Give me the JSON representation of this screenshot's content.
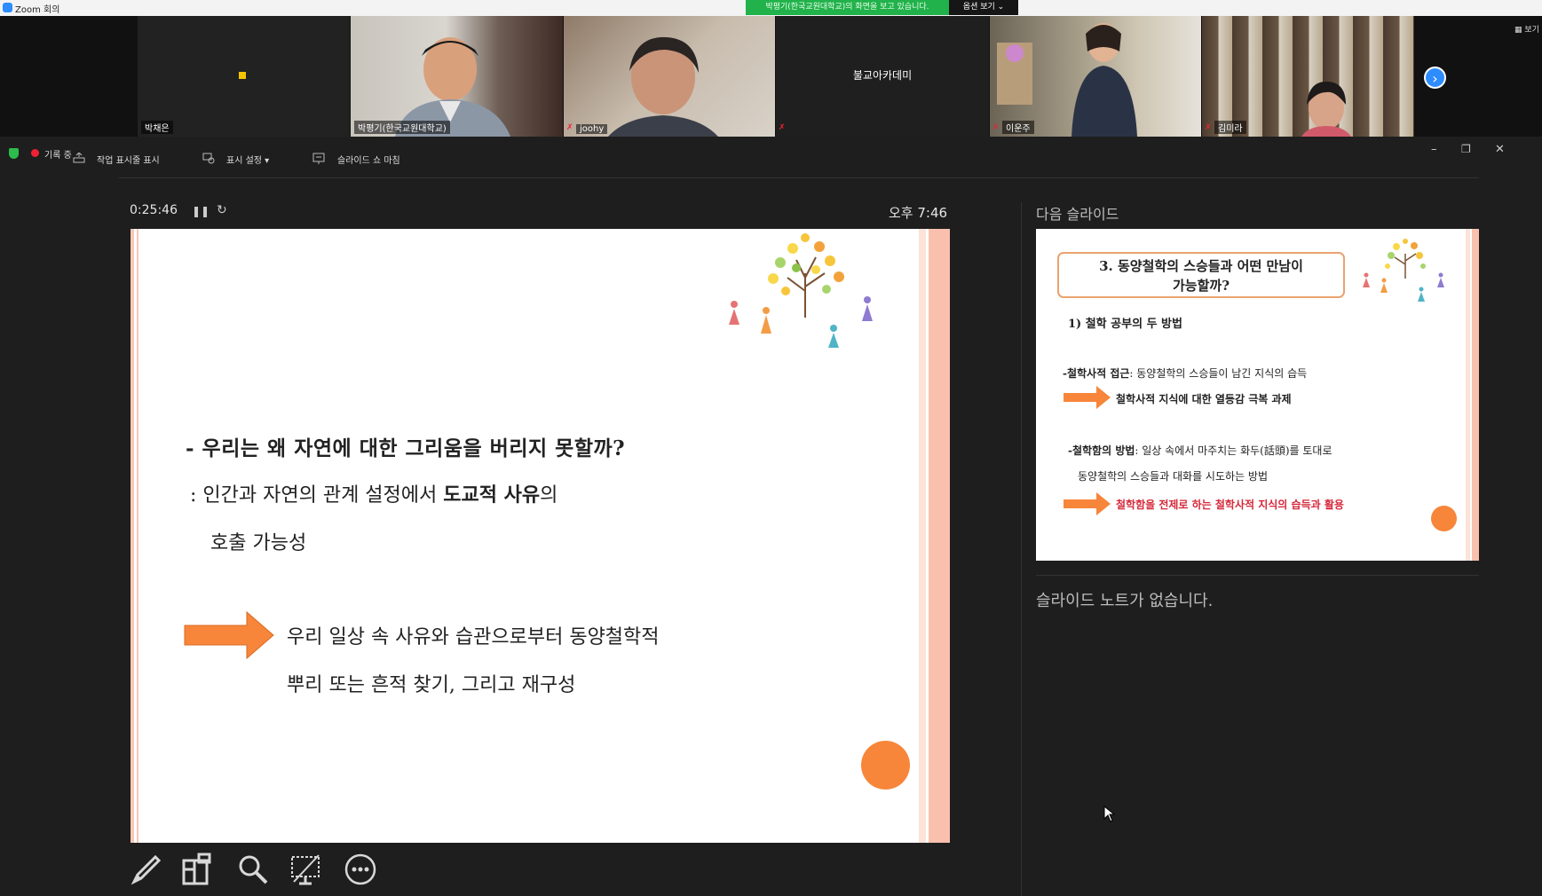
{
  "window": {
    "title": "Zoom 회의"
  },
  "share_banner": "박평기(한국교원대학교)의 화면을 보고 있습니다.",
  "view_options": "옵션 보기 ⌄",
  "gallery_button": "▦ 보기",
  "participants": [
    {
      "name": "박채은",
      "video": false
    },
    {
      "name": "박평기(한국교원대학교)",
      "video": true
    },
    {
      "name": "joohy",
      "video": true,
      "muted": true
    },
    {
      "name": "불교아카데미",
      "video": false,
      "muted": true
    },
    {
      "name": "이운주",
      "video": true,
      "muted": true
    },
    {
      "name": "김미라",
      "video": true,
      "muted": true
    }
  ],
  "toolbar": {
    "recording": "기록 중",
    "show_taskbar": "작업 표시줄 표시",
    "display_settings": "표시 설정 ▾",
    "end_slideshow": "슬라이드 쇼 마침"
  },
  "presenter": {
    "timer": "0:25:46",
    "clock": "오후 7:46",
    "current_slide": {
      "question": "- 우리는 왜 자연에 대한 그리움을 버리지 못할까?",
      "answer_line1_pre": ":  인간과 자연의 관계 설정에서 ",
      "answer_line1_bold": "도교적 사유",
      "answer_line1_post": "의",
      "answer_line2": "호출 가능성",
      "conclusion_line1": "우리 일상 속 사유와 습관으로부터 동양철학적",
      "conclusion_line2": "뿌리 또는 흔적 찾기, 그리고 재구성"
    },
    "next_slide_label": "다음 슬라이드",
    "next_slide": {
      "title_line1": "3. 동양철학의 스승들과 어떤 만남이",
      "title_line2": "가능할까?",
      "subtitle": "1) 철학 공부의 두 방법",
      "item1_bold": "-철학사적 접근",
      "item1_rest": ": 동양철학의 스승들이 남긴 지식의 습득",
      "item1_arrow": "철학사적 지식에 대한 열등감 극복 과제",
      "item2_bold": "-철학함의 방법",
      "item2_rest": ": 일상 속에서 마주치는 화두(話頭)를 토대로",
      "item2_cont": "동양철학의 스승들과 대화를 시도하는 방법",
      "item2_arrow": "철학함을 전제로 하는 철학사적 지식의 습득과 활용"
    },
    "notes": "슬라이드 노트가 없습니다."
  },
  "colors": {
    "accent_orange": "#f7863a",
    "zoom_blue": "#2d8cff",
    "banner_green": "#21b24b",
    "highlight_red": "#d6283a"
  }
}
